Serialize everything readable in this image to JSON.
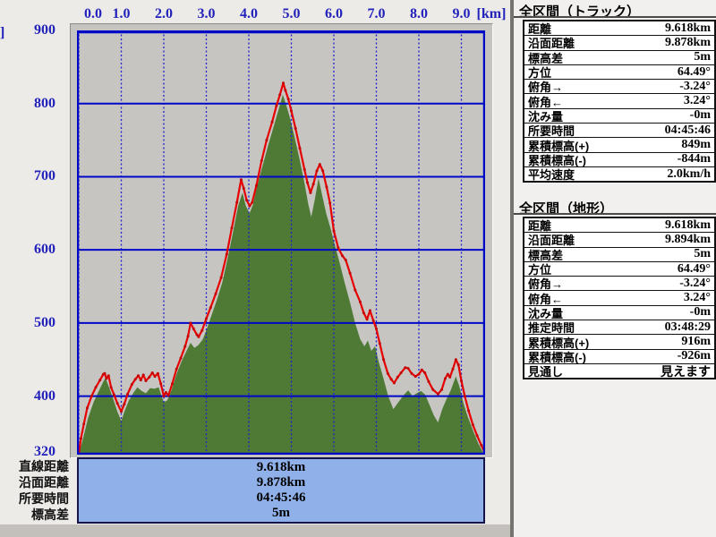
{
  "colors": {
    "axis_text": "#2222bb",
    "grid_blue": "#0008c8",
    "track_red": "#e60000",
    "track_red_dark": "#c40000",
    "terrain_green": "#4e7a36",
    "plot_bg": "#c6c5c2",
    "summary_bg": "#8fb0e8",
    "left_bg": "#edebe7",
    "panel_bg": "#f1f0ee",
    "table_bg": "#ffffff"
  },
  "axes": {
    "x_unit_label": "[km]",
    "y_unit_label_clipped": "]",
    "x_tick_labels": [
      "0.0",
      "1.0",
      "2.0",
      "3.0",
      "4.0",
      "5.0",
      "6.0",
      "7.0",
      "8.0",
      "9.0"
    ],
    "x_tick_values": [
      0,
      1,
      2,
      3,
      4,
      5,
      6,
      7,
      8,
      9
    ],
    "y_tick_labels": [
      "900",
      "800",
      "700",
      "600",
      "500",
      "400",
      "320"
    ],
    "y_tick_values": [
      900,
      800,
      700,
      600,
      500,
      400,
      320
    ]
  },
  "chart_data": {
    "type": "area",
    "title": "Elevation profile",
    "xlabel": "[km]",
    "ylabel": "[m]",
    "xlim": [
      0,
      9.55
    ],
    "ylim": [
      320,
      900
    ],
    "grid": true,
    "x_gridlines_km": [
      0,
      1,
      2,
      3,
      4,
      5,
      6,
      7,
      8,
      9
    ],
    "y_gridlines_m": [
      800,
      700,
      600,
      500,
      400
    ],
    "series": [
      {
        "name": "track",
        "style": "line",
        "color": "#e60000",
        "points": [
          [
            0.0,
            320
          ],
          [
            0.05,
            342
          ],
          [
            0.12,
            362
          ],
          [
            0.2,
            384
          ],
          [
            0.3,
            400
          ],
          [
            0.4,
            412
          ],
          [
            0.5,
            422
          ],
          [
            0.58,
            430
          ],
          [
            0.61,
            431
          ],
          [
            0.65,
            424
          ],
          [
            0.7,
            428
          ],
          [
            0.76,
            412
          ],
          [
            0.83,
            402
          ],
          [
            0.91,
            390
          ],
          [
            1.0,
            379
          ],
          [
            1.07,
            389
          ],
          [
            1.15,
            403
          ],
          [
            1.25,
            416
          ],
          [
            1.33,
            423
          ],
          [
            1.4,
            428
          ],
          [
            1.46,
            422
          ],
          [
            1.52,
            429
          ],
          [
            1.58,
            421
          ],
          [
            1.66,
            426
          ],
          [
            1.73,
            432
          ],
          [
            1.79,
            427
          ],
          [
            1.86,
            431
          ],
          [
            1.93,
            417
          ],
          [
            2.0,
            400
          ],
          [
            2.05,
            405
          ],
          [
            2.11,
            401
          ],
          [
            2.2,
            417
          ],
          [
            2.3,
            437
          ],
          [
            2.4,
            452
          ],
          [
            2.5,
            468
          ],
          [
            2.57,
            482
          ],
          [
            2.63,
            500
          ],
          [
            2.7,
            492
          ],
          [
            2.78,
            484
          ],
          [
            2.82,
            481
          ],
          [
            2.9,
            490
          ],
          [
            3.0,
            506
          ],
          [
            3.1,
            521
          ],
          [
            3.22,
            540
          ],
          [
            3.35,
            562
          ],
          [
            3.48,
            594
          ],
          [
            3.6,
            630
          ],
          [
            3.72,
            665
          ],
          [
            3.82,
            696
          ],
          [
            3.88,
            684
          ],
          [
            3.95,
            668
          ],
          [
            4.02,
            660
          ],
          [
            4.08,
            665
          ],
          [
            4.18,
            688
          ],
          [
            4.3,
            722
          ],
          [
            4.42,
            750
          ],
          [
            4.55,
            775
          ],
          [
            4.65,
            797
          ],
          [
            4.73,
            812
          ],
          [
            4.81,
            828
          ],
          [
            4.86,
            818
          ],
          [
            4.93,
            806
          ],
          [
            5.0,
            790
          ],
          [
            5.1,
            766
          ],
          [
            5.2,
            739
          ],
          [
            5.31,
            710
          ],
          [
            5.38,
            692
          ],
          [
            5.45,
            678
          ],
          [
            5.52,
            690
          ],
          [
            5.6,
            708
          ],
          [
            5.67,
            717
          ],
          [
            5.74,
            708
          ],
          [
            5.83,
            686
          ],
          [
            5.91,
            664
          ],
          [
            6.0,
            626
          ],
          [
            6.1,
            603
          ],
          [
            6.2,
            592
          ],
          [
            6.28,
            586
          ],
          [
            6.38,
            568
          ],
          [
            6.5,
            545
          ],
          [
            6.62,
            529
          ],
          [
            6.7,
            514
          ],
          [
            6.78,
            505
          ],
          [
            6.85,
            517
          ],
          [
            6.93,
            503
          ],
          [
            7.0,
            492
          ],
          [
            7.08,
            472
          ],
          [
            7.17,
            450
          ],
          [
            7.27,
            431
          ],
          [
            7.35,
            423
          ],
          [
            7.42,
            418
          ],
          [
            7.5,
            426
          ],
          [
            7.58,
            432
          ],
          [
            7.68,
            439
          ],
          [
            7.75,
            438
          ],
          [
            7.83,
            431
          ],
          [
            7.92,
            427
          ],
          [
            8.0,
            430
          ],
          [
            8.07,
            436
          ],
          [
            8.14,
            432
          ],
          [
            8.23,
            420
          ],
          [
            8.33,
            409
          ],
          [
            8.45,
            403
          ],
          [
            8.54,
            409
          ],
          [
            8.62,
            424
          ],
          [
            8.68,
            430
          ],
          [
            8.73,
            426
          ],
          [
            8.8,
            437
          ],
          [
            8.87,
            450
          ],
          [
            8.93,
            443
          ],
          [
            9.0,
            421
          ],
          [
            9.08,
            400
          ],
          [
            9.17,
            380
          ],
          [
            9.27,
            361
          ],
          [
            9.37,
            346
          ],
          [
            9.47,
            333
          ],
          [
            9.55,
            323
          ]
        ]
      },
      {
        "name": "terrain",
        "style": "filled-area",
        "color": "#4e7a36",
        "points": [
          [
            0.0,
            320
          ],
          [
            0.1,
            342
          ],
          [
            0.22,
            370
          ],
          [
            0.35,
            392
          ],
          [
            0.48,
            408
          ],
          [
            0.58,
            420
          ],
          [
            0.63,
            425
          ],
          [
            0.7,
            414
          ],
          [
            0.8,
            398
          ],
          [
            0.9,
            380
          ],
          [
            1.0,
            366
          ],
          [
            1.08,
            380
          ],
          [
            1.18,
            394
          ],
          [
            1.28,
            404
          ],
          [
            1.38,
            412
          ],
          [
            1.48,
            407
          ],
          [
            1.58,
            404
          ],
          [
            1.68,
            411
          ],
          [
            1.78,
            410
          ],
          [
            1.88,
            412
          ],
          [
            1.95,
            400
          ],
          [
            2.0,
            392
          ],
          [
            2.08,
            394
          ],
          [
            2.18,
            408
          ],
          [
            2.3,
            430
          ],
          [
            2.42,
            448
          ],
          [
            2.52,
            460
          ],
          [
            2.63,
            473
          ],
          [
            2.72,
            466
          ],
          [
            2.82,
            470
          ],
          [
            2.92,
            478
          ],
          [
            3.0,
            490
          ],
          [
            3.12,
            510
          ],
          [
            3.25,
            532
          ],
          [
            3.38,
            556
          ],
          [
            3.5,
            588
          ],
          [
            3.62,
            622
          ],
          [
            3.75,
            660
          ],
          [
            3.85,
            678
          ],
          [
            3.93,
            660
          ],
          [
            4.02,
            650
          ],
          [
            4.1,
            662
          ],
          [
            4.2,
            688
          ],
          [
            4.32,
            714
          ],
          [
            4.45,
            742
          ],
          [
            4.58,
            768
          ],
          [
            4.7,
            792
          ],
          [
            4.8,
            812
          ],
          [
            4.88,
            798
          ],
          [
            4.97,
            780
          ],
          [
            5.07,
            756
          ],
          [
            5.18,
            728
          ],
          [
            5.3,
            694
          ],
          [
            5.4,
            662
          ],
          [
            5.47,
            645
          ],
          [
            5.55,
            668
          ],
          [
            5.64,
            698
          ],
          [
            5.72,
            676
          ],
          [
            5.82,
            650
          ],
          [
            5.92,
            630
          ],
          [
            6.0,
            612
          ],
          [
            6.12,
            586
          ],
          [
            6.25,
            556
          ],
          [
            6.38,
            528
          ],
          [
            6.5,
            500
          ],
          [
            6.62,
            478
          ],
          [
            6.72,
            468
          ],
          [
            6.8,
            476
          ],
          [
            6.88,
            462
          ],
          [
            6.97,
            468
          ],
          [
            7.05,
            448
          ],
          [
            7.15,
            428
          ],
          [
            7.28,
            400
          ],
          [
            7.4,
            382
          ],
          [
            7.52,
            392
          ],
          [
            7.65,
            402
          ],
          [
            7.75,
            408
          ],
          [
            7.85,
            400
          ],
          [
            7.95,
            404
          ],
          [
            8.05,
            407
          ],
          [
            8.15,
            402
          ],
          [
            8.25,
            388
          ],
          [
            8.35,
            374
          ],
          [
            8.45,
            364
          ],
          [
            8.55,
            382
          ],
          [
            8.65,
            396
          ],
          [
            8.75,
            408
          ],
          [
            8.87,
            427
          ],
          [
            8.95,
            414
          ],
          [
            9.05,
            390
          ],
          [
            9.15,
            372
          ],
          [
            9.28,
            352
          ],
          [
            9.4,
            335
          ],
          [
            9.52,
            322
          ],
          [
            9.55,
            320
          ]
        ]
      }
    ]
  },
  "bottom_labels": [
    "直線距離",
    "沿面距離",
    "所要時間",
    "標高差"
  ],
  "summary_box": {
    "values": [
      "9.618km",
      "9.878km",
      "04:45:46",
      "5m"
    ]
  },
  "panels": [
    {
      "title": "全区間（トラック）",
      "rows": [
        {
          "label": "距離",
          "value": "9.618km"
        },
        {
          "label": "沿面距離",
          "value": "9.878km"
        },
        {
          "label": "標高差",
          "value": "5m"
        },
        {
          "label": "方位",
          "value": "64.49°"
        },
        {
          "label": "俯角→",
          "value": "-3.24°"
        },
        {
          "label": "俯角←",
          "value": "3.24°"
        },
        {
          "label": "沈み量",
          "value": "-0m"
        },
        {
          "label": "所要時間",
          "value": "04:45:46"
        },
        {
          "label": "累積標高(+)",
          "value": "849m"
        },
        {
          "label": "累積標高(-)",
          "value": "-844m"
        },
        {
          "label": "平均速度",
          "value": "2.0km/h"
        }
      ]
    },
    {
      "title": "全区間（地形）",
      "rows": [
        {
          "label": "距離",
          "value": "9.618km"
        },
        {
          "label": "沿面距離",
          "value": "9.894km"
        },
        {
          "label": "標高差",
          "value": "5m"
        },
        {
          "label": "方位",
          "value": "64.49°"
        },
        {
          "label": "俯角→",
          "value": "-3.24°"
        },
        {
          "label": "俯角←",
          "value": "3.24°"
        },
        {
          "label": "沈み量",
          "value": "-0m"
        },
        {
          "label": "推定時間",
          "value": "03:48:29"
        },
        {
          "label": "累積標高(+)",
          "value": "916m"
        },
        {
          "label": "累積標高(-)",
          "value": "-926m"
        },
        {
          "label": "見通し",
          "value": "見えます"
        }
      ]
    }
  ]
}
